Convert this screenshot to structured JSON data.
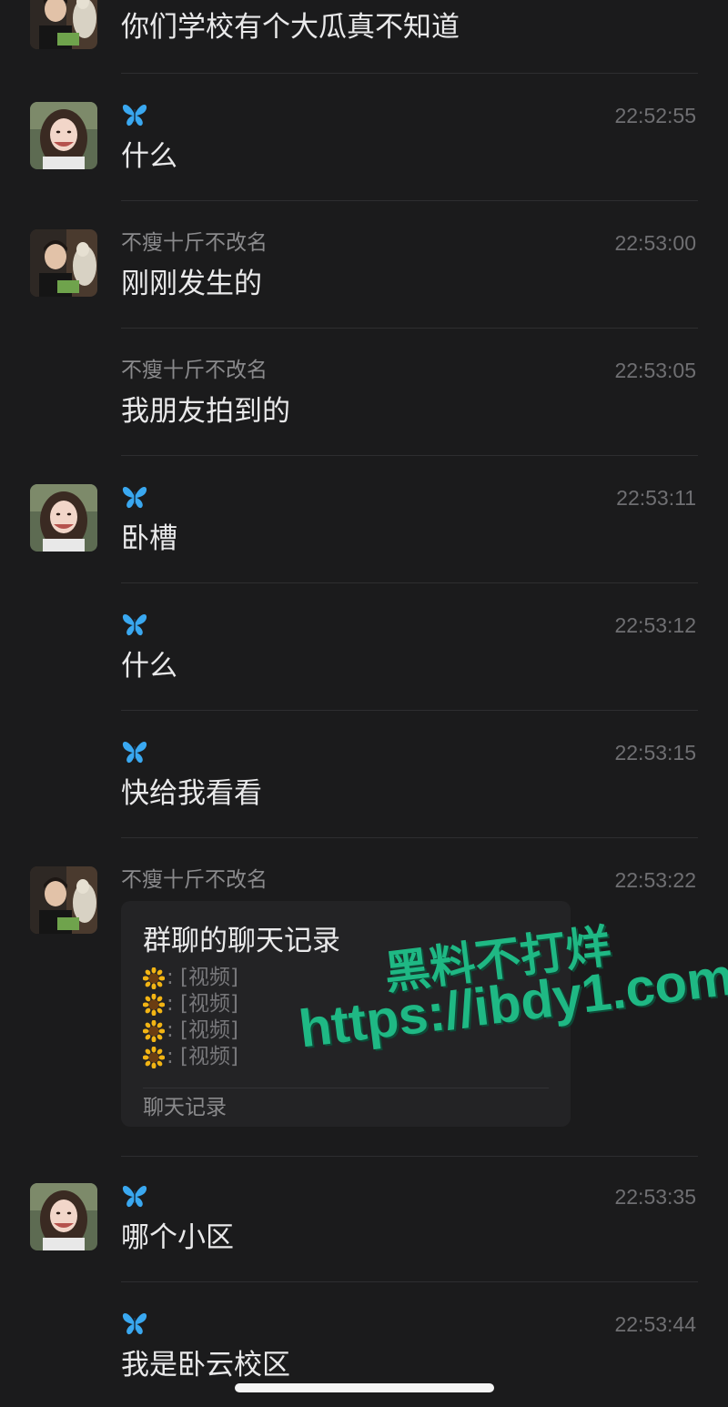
{
  "messages": [
    {
      "avatar": "boy-avatar",
      "name": "",
      "icon": "",
      "time": "",
      "text": "你们学校有个大瓜真不知道"
    },
    {
      "avatar": "girl-avatar",
      "name": "",
      "icon": "butterfly-icon",
      "time": "22:52:55",
      "text": "什么"
    },
    {
      "avatar": "boy-avatar",
      "name": "不瘦十斤不改名",
      "icon": "",
      "time": "22:53:00",
      "text": "刚刚发生的"
    },
    {
      "avatar": "",
      "name": "不瘦十斤不改名",
      "icon": "",
      "time": "22:53:05",
      "text": "我朋友拍到的"
    },
    {
      "avatar": "girl-avatar",
      "name": "",
      "icon": "butterfly-icon",
      "time": "22:53:11",
      "text": "卧槽"
    },
    {
      "avatar": "",
      "name": "",
      "icon": "butterfly-icon",
      "time": "22:53:12",
      "text": "什么"
    },
    {
      "avatar": "",
      "name": "",
      "icon": "butterfly-icon",
      "time": "22:53:15",
      "text": "快给我看看"
    },
    {
      "avatar": "boy-avatar",
      "name": "不瘦十斤不改名",
      "icon": "",
      "time": "22:53:22",
      "text": ""
    },
    {
      "avatar": "girl-avatar",
      "name": "",
      "icon": "butterfly-icon",
      "time": "22:53:35",
      "text": "哪个小区"
    },
    {
      "avatar": "",
      "name": "",
      "icon": "butterfly-icon",
      "time": "22:53:44",
      "text": "我是卧云校区"
    }
  ],
  "chat_record_card": {
    "title": "群聊的聊天记录",
    "lines": [
      ": [视频]",
      ": [视频]",
      ": [视频]",
      ": [视频]"
    ],
    "line_icon": "sunflower-icon",
    "footer": "聊天记录"
  },
  "watermark": {
    "line1": "黑料不打烊",
    "line2": "https://ibdy1.com",
    "color": "#1fb884"
  },
  "colors": {
    "background": "#1b1b1c",
    "butterfly": "#3aa8f0"
  }
}
